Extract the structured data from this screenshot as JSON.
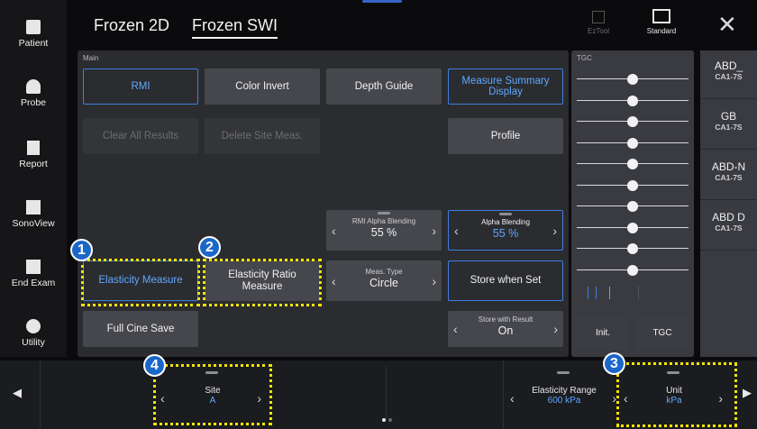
{
  "sidebar": {
    "items": [
      {
        "label": "Patient",
        "icon": "patient-icon"
      },
      {
        "label": "Probe",
        "icon": "probe-icon"
      },
      {
        "label": "Report",
        "icon": "report-icon"
      },
      {
        "label": "SonoView",
        "icon": "sonoview-icon"
      },
      {
        "label": "End Exam",
        "icon": "end-exam-icon"
      },
      {
        "label": "Utility",
        "icon": "utility-icon"
      }
    ]
  },
  "header": {
    "tabs": [
      {
        "label": "Frozen 2D",
        "active": false
      },
      {
        "label": "Frozen SWI",
        "active": true
      }
    ],
    "eztool_label": "EzTool",
    "standard_label": "Standard",
    "close_icon": "close-icon"
  },
  "main": {
    "section_label": "Main",
    "buttons": {
      "rmi": "RMI",
      "color_invert": "Color Invert",
      "depth_guide": "Depth Guide",
      "measure_summary": "Measure Summary Display",
      "clear_all": "Clear All Results",
      "delete_site": "Delete Site Meas.",
      "profile": "Profile",
      "elasticity_measure": "Elasticity Measure",
      "elasticity_ratio": "Elasticity Ratio Measure",
      "store_when_set": "Store when Set",
      "full_cine_save": "Full Cine Save"
    },
    "steppers": {
      "rmi_alpha": {
        "caption": "RMI Alpha Blending",
        "value": "55 %"
      },
      "alpha": {
        "caption": "Alpha Blending",
        "value": "55 %"
      },
      "meas_type": {
        "caption": "Meas. Type",
        "value": "Circle"
      },
      "store_result": {
        "caption": "Store with Result",
        "value": "On"
      }
    }
  },
  "tgc": {
    "section_label": "TGC",
    "slider_positions": [
      0.5,
      0.5,
      0.5,
      0.5,
      0.5,
      0.5,
      0.5,
      0.5,
      0.5,
      0.5
    ],
    "init_label": "Init.",
    "tgc_label": "TGC"
  },
  "presets": [
    {
      "name": "ABD_",
      "probe": "CA1-7S"
    },
    {
      "name": "GB",
      "probe": "CA1-7S"
    },
    {
      "name": "ABD-N",
      "probe": "CA1-7S"
    },
    {
      "name": "ABD D",
      "probe": "CA1-7S"
    }
  ],
  "bottom": {
    "site": {
      "caption": "Site",
      "value": "A"
    },
    "elasticity_range": {
      "caption": "Elasticity Range",
      "value": "600 kPa"
    },
    "unit": {
      "caption": "Unit",
      "value": "kPa"
    }
  },
  "annotations": {
    "badge1": "1",
    "badge2": "2",
    "badge3": "3",
    "badge4": "4",
    "color": "#f2e600",
    "badge_color": "#1b66c9"
  },
  "colors": {
    "accent_blue": "#3d7ee0",
    "value_blue": "#5ea8ff"
  }
}
